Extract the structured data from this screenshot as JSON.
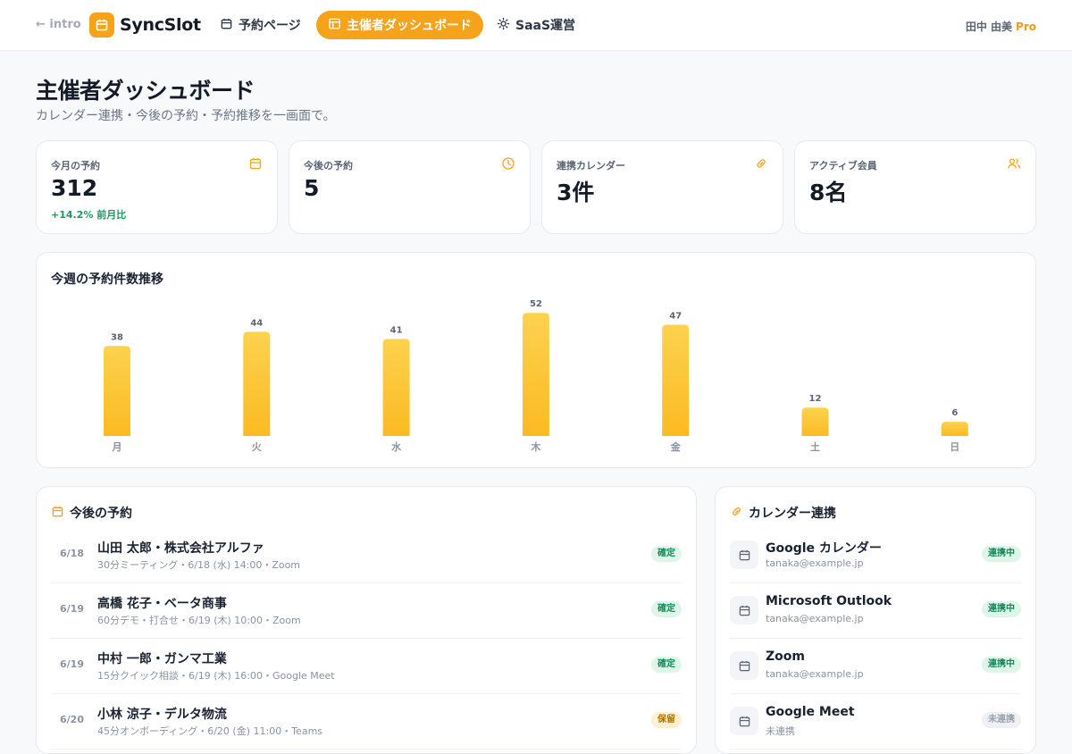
{
  "topbar": {
    "back_label": "← intro",
    "brand": "SyncSlot",
    "nav": [
      {
        "label": "予約ページ",
        "icon": "calendar-icon"
      },
      {
        "label": "主催者ダッシュボード",
        "icon": "layout-icon",
        "active": true
      },
      {
        "label": "SaaS運営",
        "icon": "gear-icon"
      }
    ],
    "user_name": "田中 由美",
    "plan": "Pro"
  },
  "header": {
    "title": "主催者ダッシュボード",
    "subtitle": "カレンダー連携・今後の予約・予約推移を一画面で。"
  },
  "stats": [
    {
      "label": "今月の予約",
      "value": "312",
      "change": "+14.2% 前月比",
      "icon": "calendar-icon"
    },
    {
      "label": "今後の予約",
      "value": "5",
      "change": "",
      "icon": "clock-icon"
    },
    {
      "label": "連携カレンダー",
      "value": "3件",
      "change": "",
      "icon": "link-icon"
    },
    {
      "label": "アクティブ会員",
      "value": "8名",
      "change": "",
      "icon": "users-icon"
    }
  ],
  "chart_data": {
    "type": "bar",
    "title": "今週の予約件数推移",
    "categories": [
      "月",
      "火",
      "水",
      "木",
      "金",
      "土",
      "日"
    ],
    "values": [
      38,
      44,
      41,
      52,
      47,
      12,
      6
    ],
    "data_labels": true,
    "grid": false,
    "legend": "none",
    "bar_color": "#fbbf24"
  },
  "upcoming": {
    "title": "今後の予約",
    "items": [
      {
        "date": "6/18",
        "name": "山田 太郎・株式会社アルファ",
        "meta": "30分ミーティング・6/18 (水) 14:00・Zoom",
        "status": "確定",
        "status_type": "green"
      },
      {
        "date": "6/19",
        "name": "高橋 花子・ベータ商事",
        "meta": "60分デモ・打合せ・6/19 (木) 10:00・Zoom",
        "status": "確定",
        "status_type": "green"
      },
      {
        "date": "6/19",
        "name": "中村 一郎・ガンマ工業",
        "meta": "15分クイック相談・6/19 (木) 16:00・Google Meet",
        "status": "確定",
        "status_type": "green"
      },
      {
        "date": "6/20",
        "name": "小林 涼子・デルタ物流",
        "meta": "45分オンボーディング・6/20 (金) 11:00・Teams",
        "status": "保留",
        "status_type": "yellow"
      }
    ]
  },
  "calendars": {
    "title": "カレンダー連携",
    "items": [
      {
        "name": "Google カレンダー",
        "account": "tanaka@example.jp",
        "status": "連携中",
        "status_type": "green"
      },
      {
        "name": "Microsoft Outlook",
        "account": "tanaka@example.jp",
        "status": "連携中",
        "status_type": "green"
      },
      {
        "name": "Zoom",
        "account": "tanaka@example.jp",
        "status": "連携中",
        "status_type": "green"
      },
      {
        "name": "Google Meet",
        "account": "未連携",
        "status": "未連携",
        "status_type": "gray"
      }
    ]
  },
  "colors": {
    "accent": "#f6a31c",
    "positive": "#1b9a5c"
  }
}
